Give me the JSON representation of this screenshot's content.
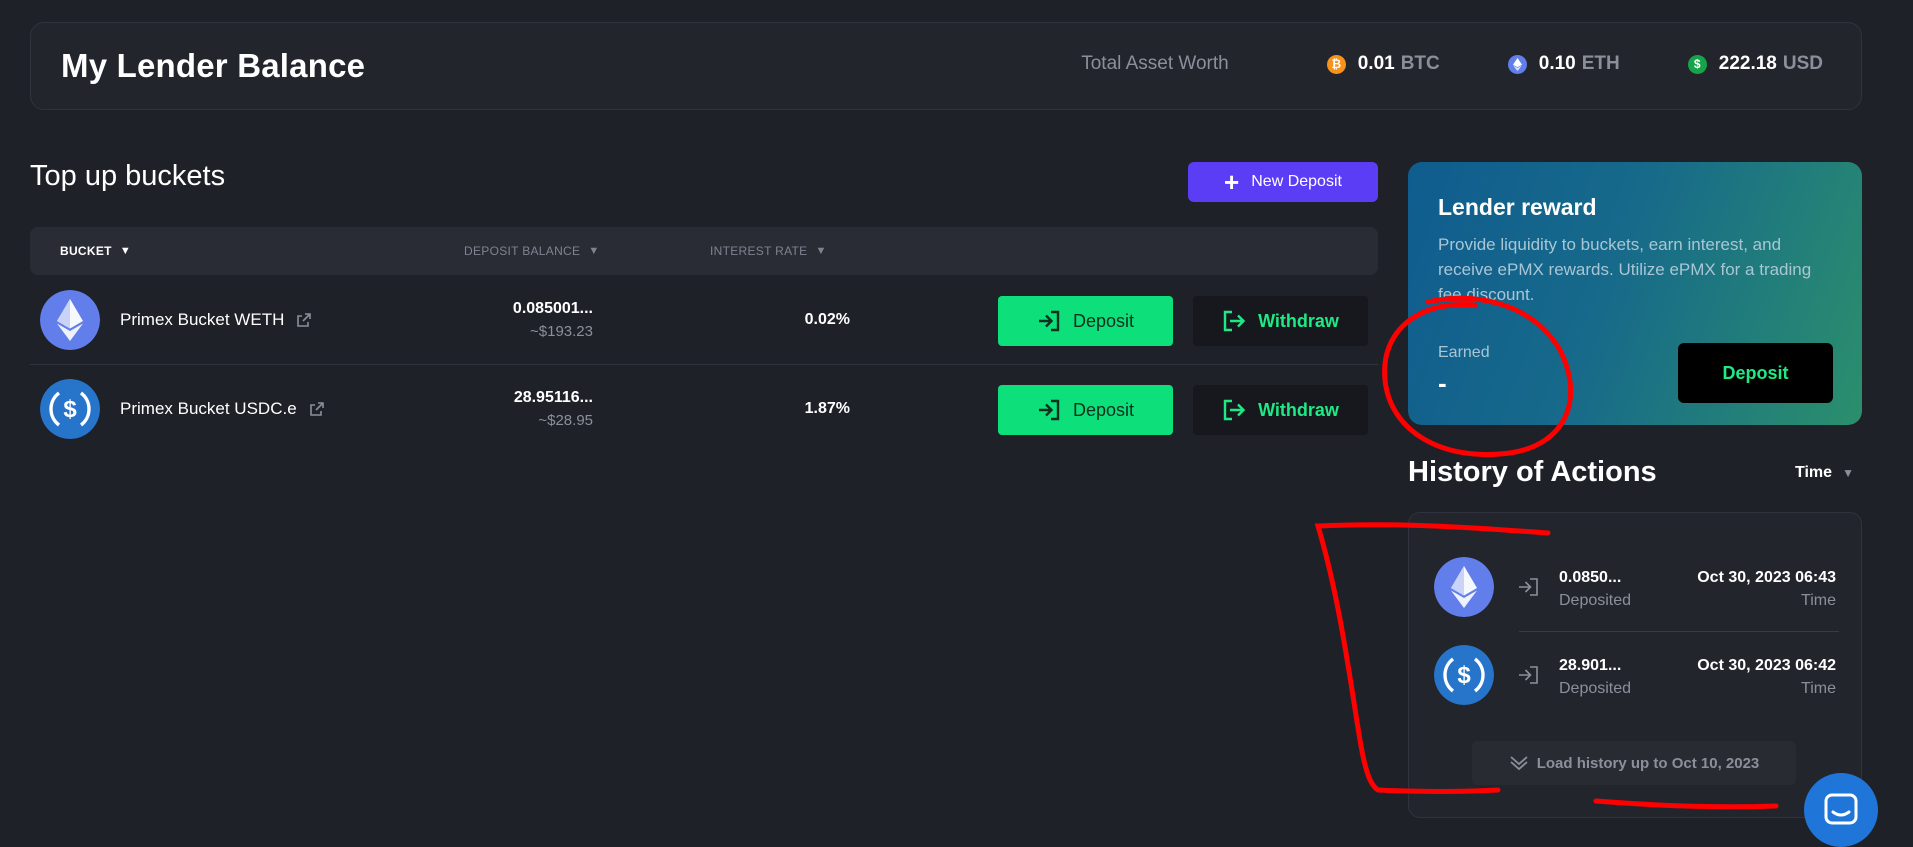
{
  "header": {
    "title": "My Lender Balance",
    "total_label": "Total Asset Worth",
    "assets": [
      {
        "amount": "0.01",
        "unit": "BTC",
        "color": "#f7931a",
        "icon": "bitcoin-icon"
      },
      {
        "amount": "0.10",
        "unit": "ETH",
        "color": "#627eea",
        "icon": "ethereum-icon"
      },
      {
        "amount": "222.18",
        "unit": "USD",
        "color": "#16a34a",
        "icon": "dollar-icon"
      }
    ]
  },
  "buckets": {
    "title": "Top up buckets",
    "new_deposit_label": "New Deposit",
    "columns": {
      "bucket": "BUCKET",
      "balance": "DEPOSIT BALANCE",
      "rate": "INTEREST RATE"
    },
    "rows": [
      {
        "name": "Primex Bucket WETH",
        "balance": "0.085001...",
        "balance_usd": "~$193.23",
        "rate": "0.02%",
        "deposit_label": "Deposit",
        "withdraw_label": "Withdraw",
        "icon": "ethereum-icon"
      },
      {
        "name": "Primex Bucket USDC.e",
        "balance": "28.95116...",
        "balance_usd": "~$28.95",
        "rate": "1.87%",
        "deposit_label": "Deposit",
        "withdraw_label": "Withdraw",
        "icon": "usdc-icon"
      }
    ]
  },
  "reward": {
    "title": "Lender reward",
    "description": "Provide liquidity to buckets, earn interest, and receive ePMX rewards. Utilize ePMX for a trading fee discount.",
    "earned_label": "Earned",
    "earned_value": "-",
    "deposit_label": "Deposit"
  },
  "history": {
    "title": "History of Actions",
    "sort_label": "Time",
    "items": [
      {
        "amount": "0.0850...",
        "status": "Deposited",
        "date": "Oct 30, 2023 06:43",
        "time_label": "Time",
        "icon": "ethereum-icon"
      },
      {
        "amount": "28.901...",
        "status": "Deposited",
        "date": "Oct 30, 2023 06:42",
        "time_label": "Time",
        "icon": "usdc-icon"
      }
    ],
    "load_more_label": "Load history up to Oct 10, 2023"
  },
  "colors": {
    "background": "#1f2128",
    "accent_purple": "#5b3df5",
    "accent_green": "#0de07a",
    "annotation_red": "#ff0000"
  }
}
